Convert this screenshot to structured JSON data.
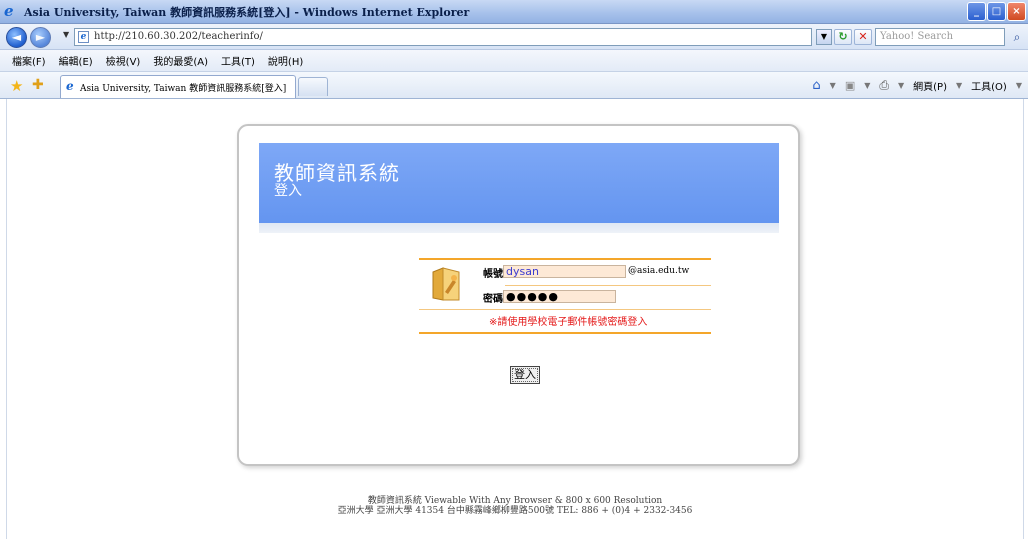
{
  "window": {
    "title": "Asia University, Taiwan 教師資訊服務系統[登入] - Windows Internet Explorer",
    "buttons": {
      "minimize": "_",
      "maximize": "□",
      "close": "×"
    }
  },
  "addressbar": {
    "url": "http://210.60.30.202/teacherinfo/",
    "search_placeholder": "Yahoo! Search"
  },
  "menubar": {
    "items": [
      "檔案(F)",
      "編輯(E)",
      "檢視(V)",
      "我的最愛(A)",
      "工具(T)",
      "說明(H)"
    ]
  },
  "tabbar": {
    "active_tab": "Asia University, Taiwan 教師資訊服務系統[登入]",
    "page_menu": "網頁(P)",
    "tools_menu": "工具(O)"
  },
  "page": {
    "banner_title": "教師資訊系統",
    "banner_subtitle": "登入",
    "login": {
      "username_label": "帳號",
      "username_value": "dysan",
      "domain_suffix": "@asia.edu.tw",
      "password_label": "密碼",
      "password_value": "●●●●●",
      "notice": "※請使用學校電子郵件帳號密碼登入",
      "submit_label": "登入"
    },
    "footer": {
      "line1": "教師資訊系統 Viewable With Any Browser & 800 x 600 Resolution",
      "line2": "亞洲大學 亞洲大學 41354 台中縣霧峰鄉柳豐路500號 TEL: 886 + (0)4 + 2332-3456"
    }
  }
}
